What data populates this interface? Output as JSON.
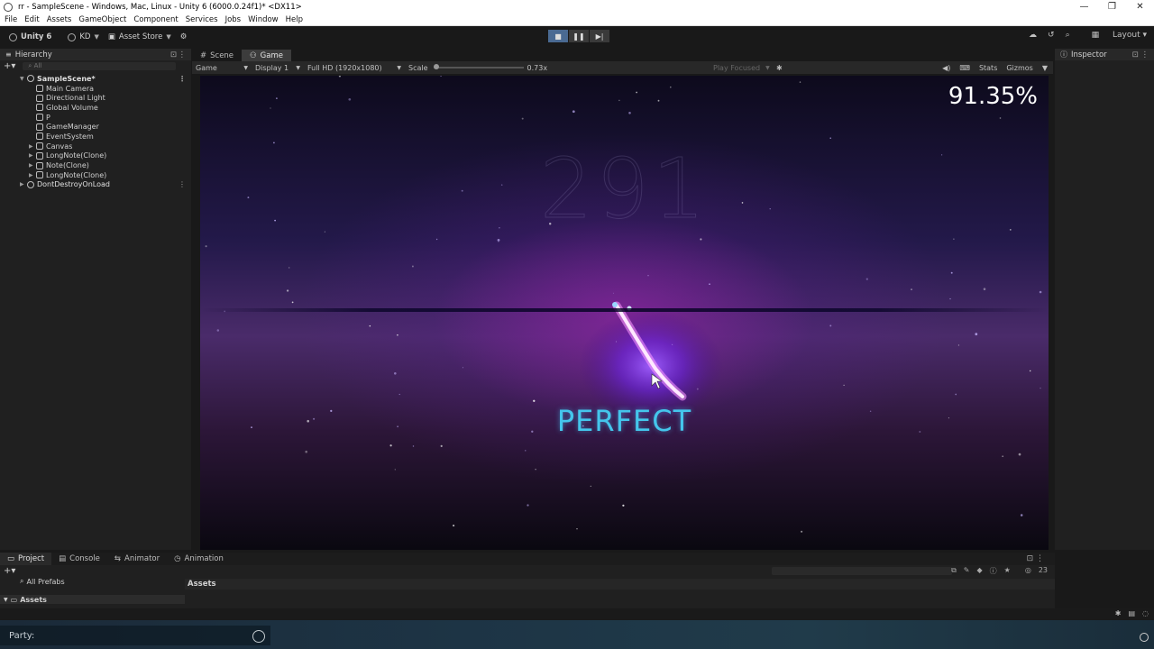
{
  "window": {
    "title": "rr - SampleScene - Windows, Mac, Linux - Unity 6 (6000.0.24f1)* <DX11>",
    "controls": [
      "—",
      "❐",
      "✕"
    ]
  },
  "menu": [
    "File",
    "Edit",
    "Assets",
    "GameObject",
    "Component",
    "Services",
    "Jobs",
    "Window",
    "Help"
  ],
  "toolbar": {
    "unity_label": "Unity 6",
    "account_label": "KD",
    "asset_store_label": "Asset Store",
    "play_controls": [
      "■",
      "❚❚",
      "▶|"
    ],
    "layout_label": "Layout"
  },
  "hierarchy": {
    "tab_label": "Hierarchy",
    "search_placeholder": "All",
    "scene_name": "SampleScene*",
    "items": [
      {
        "label": "Main Camera",
        "expandable": false
      },
      {
        "label": "Directional Light",
        "expandable": false
      },
      {
        "label": "Global Volume",
        "expandable": false
      },
      {
        "label": "P",
        "expandable": false
      },
      {
        "label": "GameManager",
        "expandable": false
      },
      {
        "label": "EventSystem",
        "expandable": false
      },
      {
        "label": "Canvas",
        "expandable": true
      },
      {
        "label": "LongNote(Clone)",
        "expandable": true
      },
      {
        "label": "Note(Clone)",
        "expandable": true
      },
      {
        "label": "LongNote(Clone)",
        "expandable": true
      }
    ],
    "dont_destroy": "DontDestroyOnLoad"
  },
  "view_tabs": {
    "scene": "Scene",
    "game": "Game"
  },
  "game_bar": {
    "mode": "Game",
    "display": "Display 1",
    "resolution": "Full HD (1920x1080)",
    "scale_label": "Scale",
    "scale_value": "0.73x",
    "play_focused": "Play Focused",
    "stats": "Stats",
    "gizmos": "Gizmos"
  },
  "game": {
    "combo": "291",
    "accuracy": "91.35%",
    "judgement": "PERFECT",
    "colors": {
      "judgement": "#44c6ec",
      "slash": "#ff66ff",
      "glow": "#7a2cff"
    }
  },
  "inspector": {
    "tab_label": "Inspector"
  },
  "bottom": {
    "tabs": [
      "Project",
      "Console",
      "Animator",
      "Animation"
    ],
    "left_items": [
      "All Prefabs",
      "Assets"
    ],
    "assets_header": "Assets",
    "count": "23"
  },
  "party": {
    "placeholder": "Party:"
  }
}
